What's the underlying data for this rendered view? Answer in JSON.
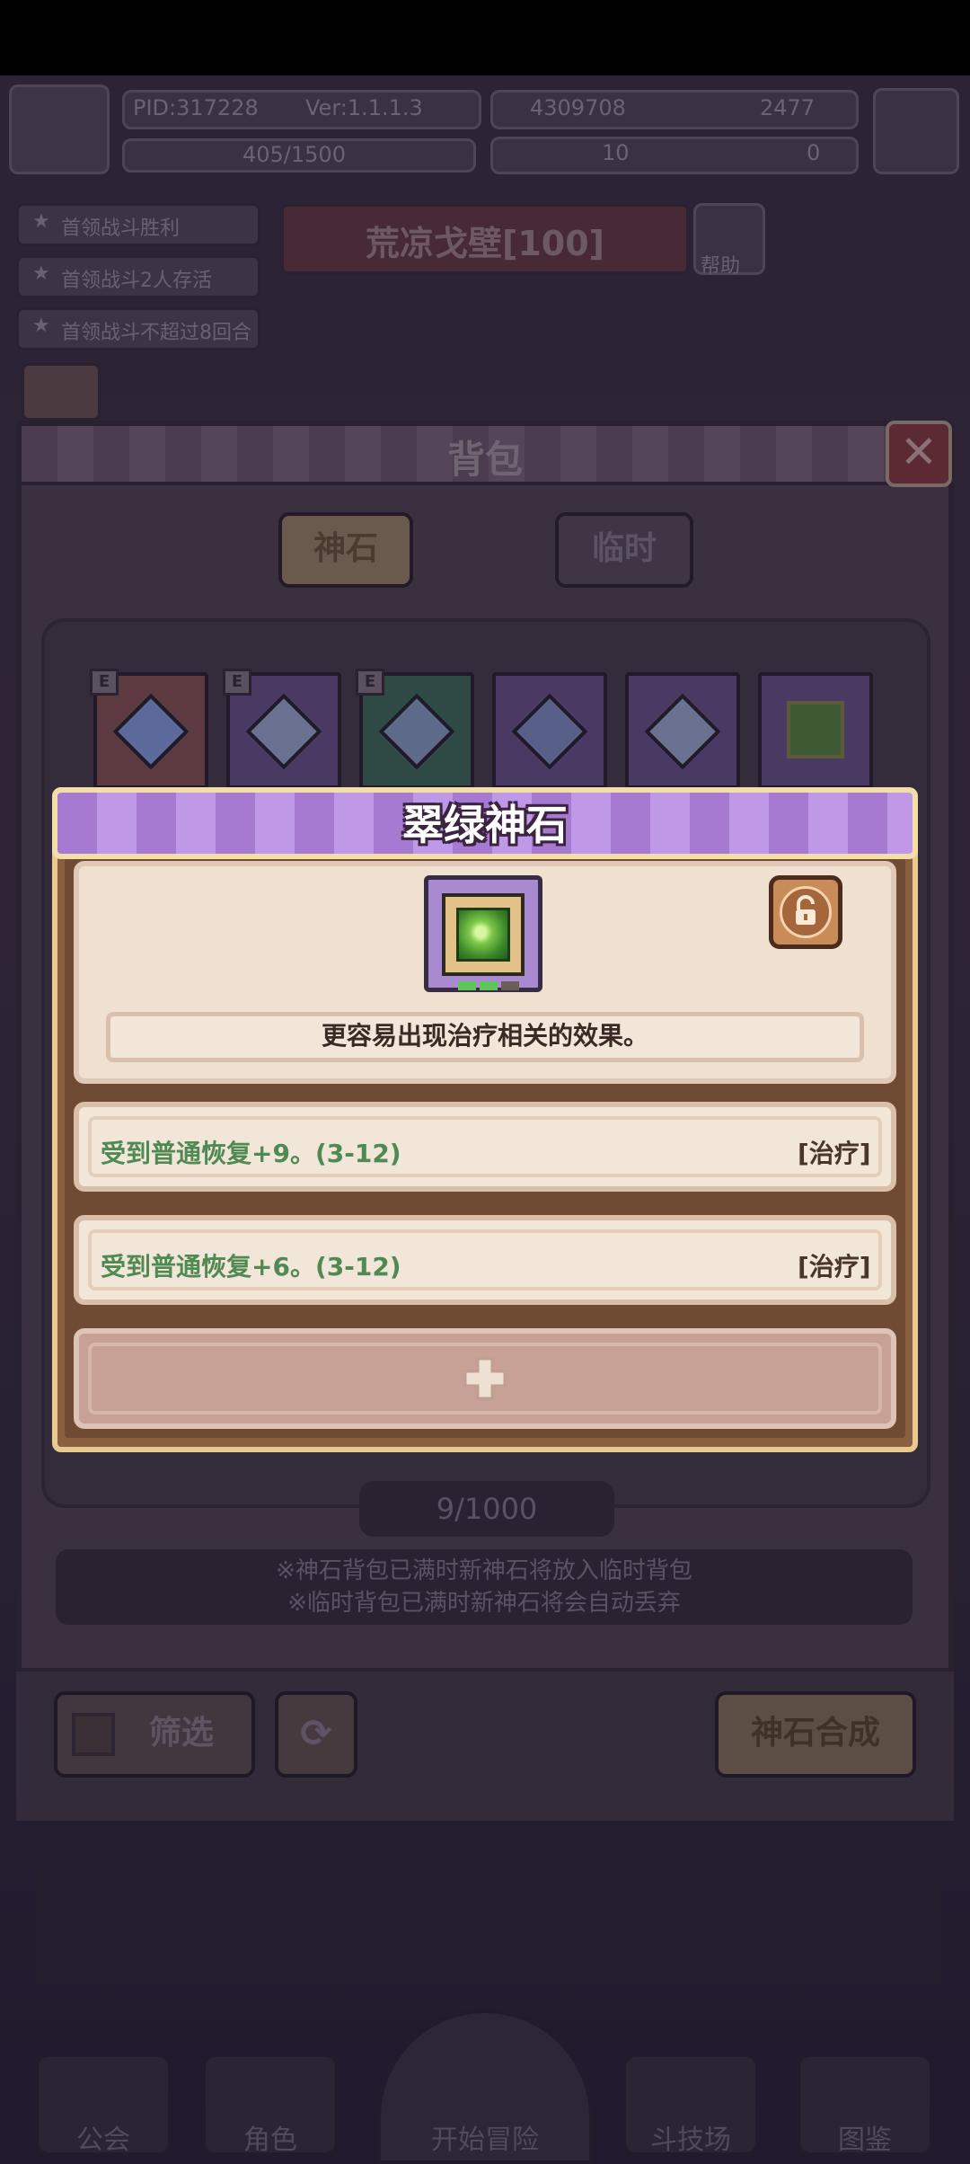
{
  "hud": {
    "pid": "PID:317228",
    "version": "Ver:1.1.1.3",
    "exp": "405/1500",
    "currency1": "4309708",
    "currency2": "2477",
    "currency3": "10",
    "currency4": "0"
  },
  "quests": [
    "首领战斗胜利",
    "首领战斗2人存活",
    "首领战斗不超过8回合"
  ],
  "stage": {
    "name": "荒凉戈壁[100]",
    "help": "帮助"
  },
  "backpack": {
    "title": "背包",
    "tabs": [
      "神石",
      "临时"
    ],
    "count": "9/1000",
    "notice": [
      "※神石背包已满时新神石将放入临时背包",
      "※临时背包已满时新神石将会自动丢弃"
    ],
    "filter_label": "筛选",
    "compose_label": "神石合成",
    "slot_marker": "E"
  },
  "nav": [
    "公会",
    "角色",
    "开始冒险",
    "斗技场",
    "图鉴"
  ],
  "popup": {
    "title": "翠绿神石",
    "description": "更容易出现治疗相关的效果。",
    "affixes": [
      {
        "text": "受到普通恢复+9。(3-12)",
        "tag": "[治疗]"
      },
      {
        "text": "受到普通恢复+6。(3-12)",
        "tag": "[治疗]"
      }
    ]
  },
  "colors": {
    "popup_header": "#b88ae0",
    "affix_text": "#4f8a54",
    "gem": "#7fc84a"
  },
  "icons": [
    "close-icon",
    "lock-open-icon",
    "plus-icon",
    "grid-icon",
    "refresh-icon",
    "help-icon"
  ]
}
